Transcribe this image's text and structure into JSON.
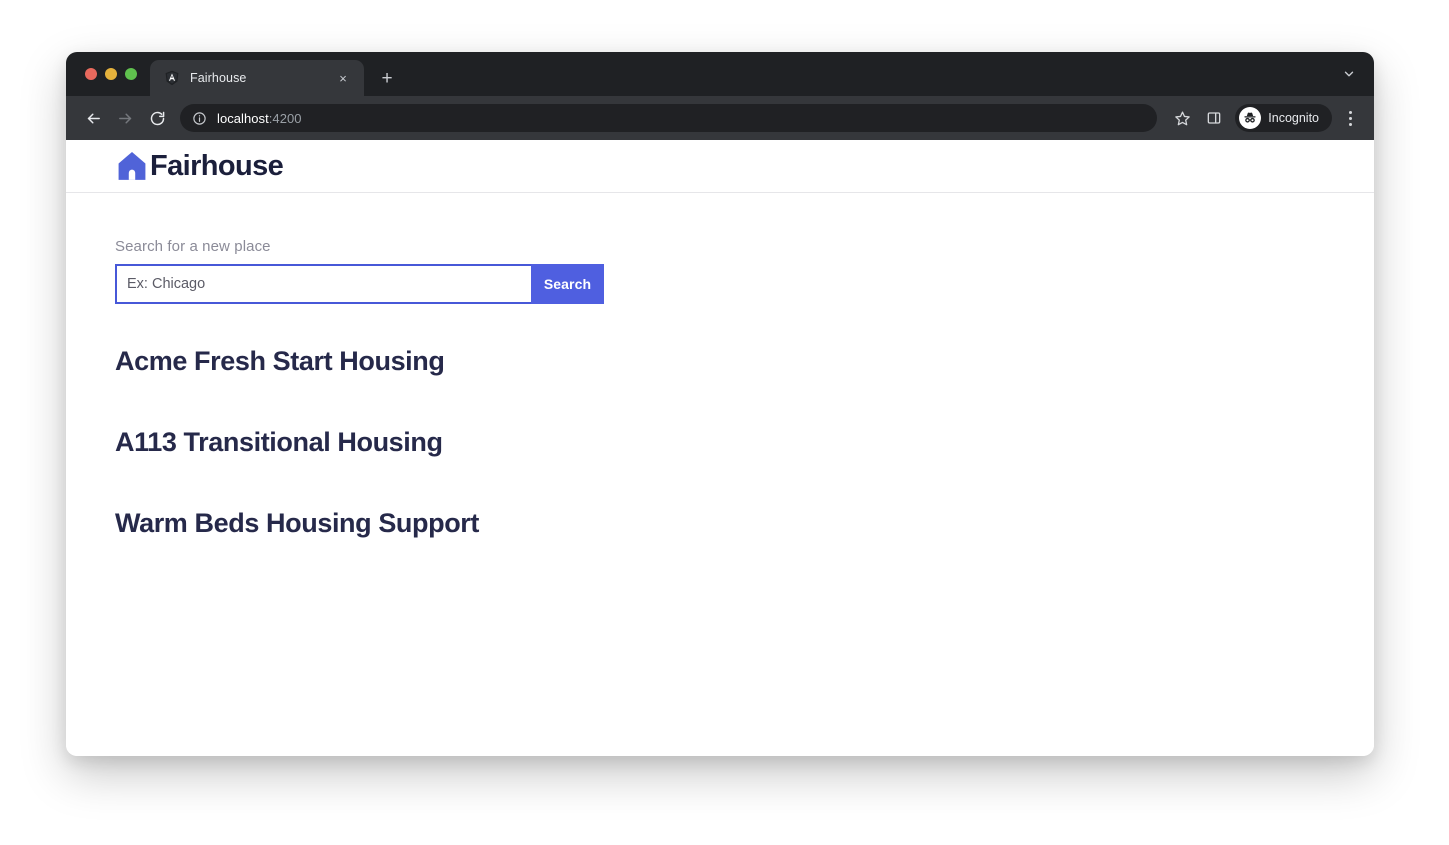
{
  "browser": {
    "traffic_lights": [
      "close",
      "minimize",
      "zoom"
    ],
    "tab": {
      "title": "Fairhouse",
      "favicon": "angular-icon",
      "close_label": "×"
    },
    "new_tab_label": "+",
    "tabstrip_chevron": "chevron-down-icon",
    "toolbar": {
      "back": "back-arrow-icon",
      "forward": "forward-arrow-icon",
      "reload": "reload-icon",
      "site_info": "info-icon",
      "url_host": "localhost",
      "url_rest": ":4200",
      "side_panel": "side-panel-icon",
      "bookmark": "star-icon",
      "profile_label": "Incognito",
      "profile_avatar": "incognito-hat-icon",
      "menu": "three-dot-menu-icon"
    }
  },
  "site": {
    "brand": {
      "name": "Fairhouse",
      "logo": "house-icon",
      "logo_color": "#5063d8"
    },
    "search": {
      "label": "Search for a new place",
      "placeholder": "Ex: Chicago",
      "value": "",
      "button_label": "Search",
      "button_color": "#4f5fe0",
      "border_color": "#4758d8"
    },
    "listings": [
      {
        "name": "Acme Fresh Start Housing"
      },
      {
        "name": "A113 Transitional Housing"
      },
      {
        "name": "Warm Beds Housing Support"
      }
    ]
  }
}
